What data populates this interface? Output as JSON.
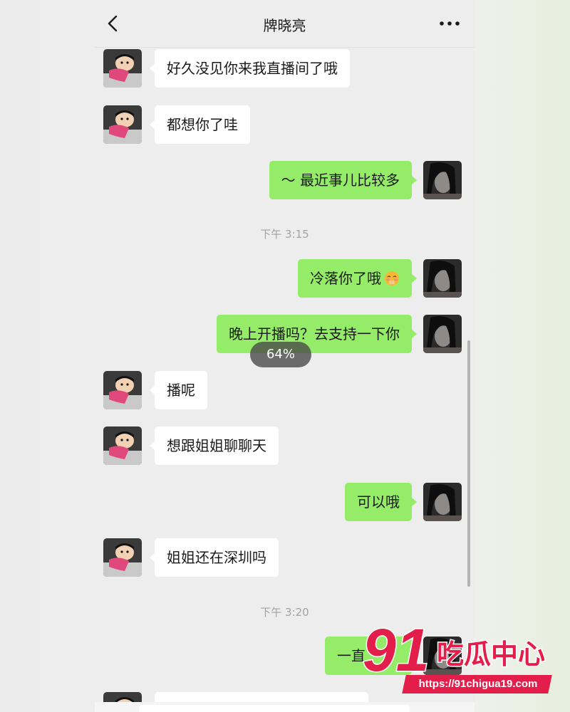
{
  "header": {
    "title": "牌晓亮"
  },
  "messages": [
    {
      "side": "left",
      "text": "好久没见你来我直播间了哦"
    },
    {
      "side": "left",
      "text": "都想你了哇"
    },
    {
      "side": "right",
      "text": "～ 最近事儿比较多"
    },
    {
      "side": "right",
      "text": "冷落你了哦"
    },
    {
      "side": "right",
      "text": "晚上开播吗？去支持一下你"
    },
    {
      "side": "left",
      "text": "播呢"
    },
    {
      "side": "left",
      "text": "想跟姐姐聊聊天"
    },
    {
      "side": "right",
      "text": "可以哦"
    },
    {
      "side": "left",
      "text": "姐姐还在深圳吗"
    },
    {
      "side": "right",
      "text": "一直"
    }
  ],
  "timestamps": [
    "下午 3:15",
    "下午 3:20"
  ],
  "overlay": {
    "progress": "64%"
  },
  "watermark": {
    "number": "91",
    "name": "吃瓜中心",
    "url": "https://91chigua19.com"
  },
  "colors": {
    "sent_bubble": "#95ec69",
    "received_bubble": "#ffffff",
    "chat_bg": "#ededed",
    "watermark": "#e41e4a"
  },
  "icons": {
    "back": "chevron-left-icon",
    "more": "more-dots-icon",
    "emoji": "blushing-face-icon"
  }
}
